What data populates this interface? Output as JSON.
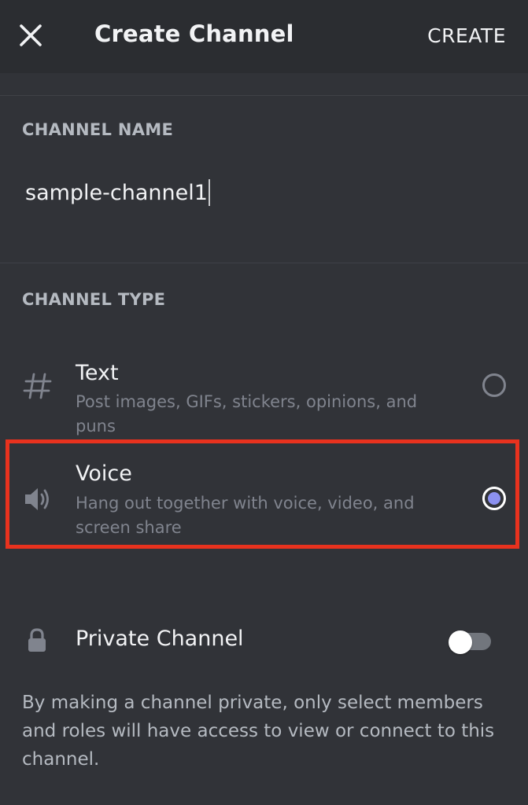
{
  "header": {
    "title": "Create Channel",
    "create_label": "CREATE",
    "close_icon": "close-icon"
  },
  "channel_name": {
    "label": "CHANNEL NAME",
    "value": "sample-channel1"
  },
  "channel_type": {
    "label": "CHANNEL TYPE",
    "selected": "Voice",
    "options": [
      {
        "title": "Text",
        "description": "Post images, GIFs, stickers, opinions, and puns",
        "icon": "hash-icon",
        "selected": false
      },
      {
        "title": "Voice",
        "description": "Hang out together with voice, video, and screen share",
        "icon": "speaker-icon",
        "selected": true
      }
    ]
  },
  "private_channel": {
    "label": "Private Channel",
    "enabled": false,
    "icon": "lock-icon",
    "help": "By making a channel private, only select members and roles will have access to view or connect to this channel."
  },
  "colors": {
    "background": "#313338",
    "header_background": "#2b2d31",
    "accent": "#8c91f0",
    "highlight": "#e8321e",
    "muted_text": "#80848e"
  }
}
